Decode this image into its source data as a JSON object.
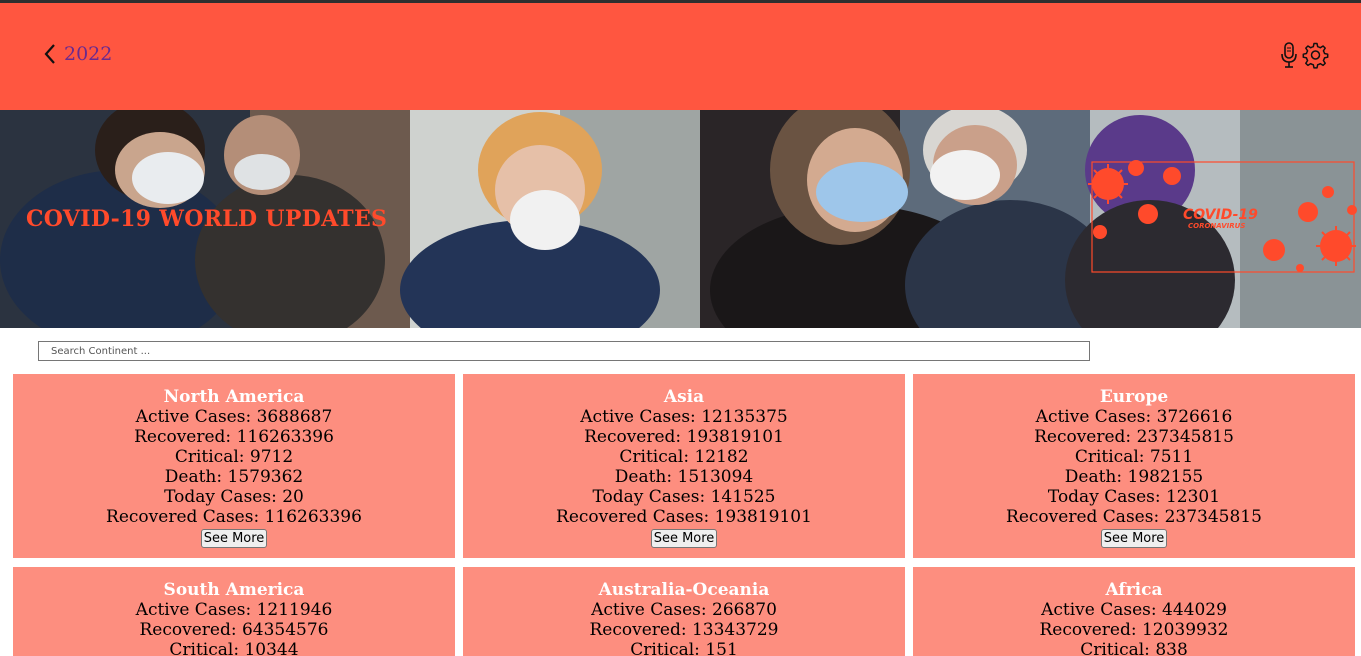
{
  "header": {
    "back_label": "2022",
    "icons": {
      "back": "chevron-left-icon",
      "mic": "microphone-icon",
      "settings": "gear-icon"
    },
    "color": "#ff5640"
  },
  "hero": {
    "title": "COVID-19 WORLD UPDATES",
    "logo_title": "COVID-19",
    "logo_subtitle": "CORONAVIRUS"
  },
  "search": {
    "placeholder": "Search Continent ..."
  },
  "labels": {
    "active": "Active Cases: ",
    "recovered": "Recovered: ",
    "critical": "Critical: ",
    "death": "Death: ",
    "today": "Today Cases: ",
    "recovered_cases": "Recovered Cases: ",
    "see_more": "See More"
  },
  "continents": [
    {
      "name": "North America",
      "active": "3688687",
      "recovered": "116263396",
      "critical": "9712",
      "death": "1579362",
      "today": "20",
      "recovered_cases": "116263396"
    },
    {
      "name": "Asia",
      "active": "12135375",
      "recovered": "193819101",
      "critical": "12182",
      "death": "1513094",
      "today": "141525",
      "recovered_cases": "193819101"
    },
    {
      "name": "Europe",
      "active": "3726616",
      "recovered": "237345815",
      "critical": "7511",
      "death": "1982155",
      "today": "12301",
      "recovered_cases": "237345815"
    },
    {
      "name": "South America",
      "active": "1211946",
      "recovered": "64354576",
      "critical": "10344"
    },
    {
      "name": "Australia-Oceania",
      "active": "266870",
      "recovered": "13343729",
      "critical": "151"
    },
    {
      "name": "Africa",
      "active": "444029",
      "recovered": "12039932",
      "critical": "838"
    }
  ],
  "colors": {
    "card_bg": "#fd8e7f",
    "accent": "#ff4a2b",
    "back_text": "#6b2a8e"
  }
}
